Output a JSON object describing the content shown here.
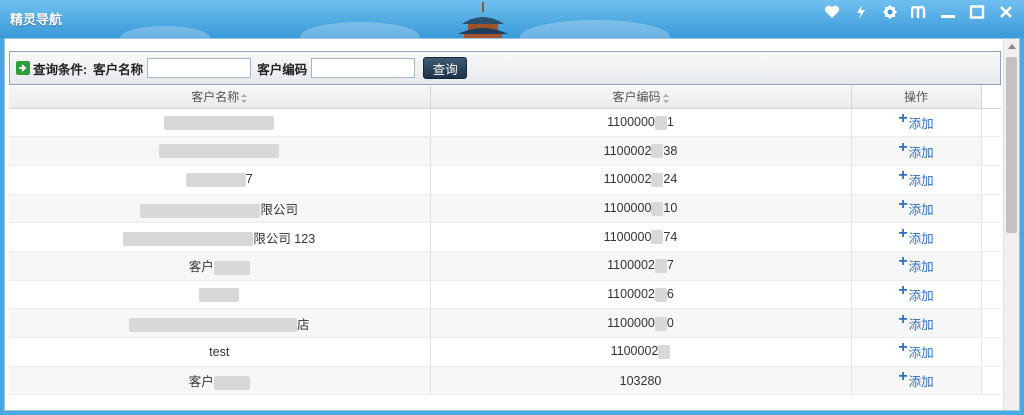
{
  "window": {
    "title": "精灵导航"
  },
  "search": {
    "condition_label": "查询条件:",
    "name_label": "客户名称",
    "name_value": "",
    "code_label": "客户编码",
    "code_value": "",
    "query_button": "查询"
  },
  "table": {
    "columns": [
      "客户名称",
      "客户编码",
      "操作"
    ],
    "rows": [
      {
        "name": "",
        "code": "1100000",
        "code_tail": "1",
        "action": "添加"
      },
      {
        "name": "",
        "code": "1100002",
        "code_tail": "38",
        "action": "添加"
      },
      {
        "name": "7",
        "code": "1100002",
        "code_tail": "24",
        "action": "添加"
      },
      {
        "name": "限公司",
        "code": "1100000",
        "code_tail": "10",
        "action": "添加"
      },
      {
        "name": "限公司 123",
        "code": "1100000",
        "code_tail": "74",
        "action": "添加"
      },
      {
        "name": "客户",
        "code": "1100002",
        "code_tail": "7",
        "action": "添加"
      },
      {
        "name": "",
        "code": "1100002",
        "code_tail": "6",
        "action": "添加"
      },
      {
        "name": "店",
        "code": "1100000",
        "code_tail": "0",
        "action": "添加"
      },
      {
        "name": "test",
        "code": "1100002",
        "code_tail": "",
        "action": "添加"
      },
      {
        "name": "客户",
        "code": "103280",
        "code_tail": "",
        "action": "添加"
      }
    ]
  },
  "colors": {
    "titlebar": "#3a9ad8",
    "link": "#2a6fc0",
    "query_button": "#1e3349"
  },
  "icons": {
    "window_controls": [
      "heart-icon",
      "lightning-icon",
      "settings-icon",
      "skin-icon",
      "minimize-icon",
      "maximize-icon",
      "close-icon"
    ],
    "search_prefix": "arrow-right-icon",
    "add": "plus-icon"
  }
}
